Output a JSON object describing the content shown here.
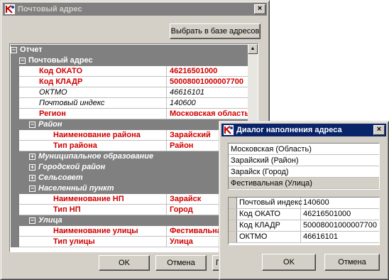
{
  "main": {
    "title": "Почтовый адрес",
    "close_glyph": "×",
    "select_button": "Выбрать в базе адресов",
    "ok_button": "OK",
    "cancel_button": "Отмена",
    "third_button": "П",
    "grid": {
      "root": "Отчет",
      "section": "Почтовый адрес",
      "rows": [
        {
          "name": "Код ОКАТО",
          "value": "46216501000"
        },
        {
          "name": "Код КЛАДР",
          "value": "50008001000007700"
        },
        {
          "name": "ОКТМО",
          "value": "46616101"
        },
        {
          "name": "Почтовый индекс",
          "value": "140600"
        },
        {
          "name": "Регион",
          "value": "Московская область"
        }
      ],
      "rayon": "Район",
      "rayon_rows": [
        {
          "name": "Наименование района",
          "value": "Зарайский"
        },
        {
          "name": "Тип района",
          "value": "Район"
        }
      ],
      "collapsed": [
        "Муниципальное образование",
        "Городской район",
        "Сельсовет"
      ],
      "np": "Населенный пункт",
      "np_rows": [
        {
          "name": "Наименование НП",
          "value": "Зарайск"
        },
        {
          "name": "Тип НП",
          "value": "Город"
        }
      ],
      "street": "Улица",
      "street_rows": [
        {
          "name": "Наименование улицы",
          "value": "Фестивальная"
        },
        {
          "name": "Тип улицы",
          "value": "Улица"
        }
      ]
    }
  },
  "address_dialog": {
    "title": "Диалог наполнения адреса",
    "close_glyph": "×",
    "levels": [
      "Московская (Область)",
      "Зарайский (Район)",
      "Зарайск (Город)",
      "Фестивальная (Улица)"
    ],
    "codes": [
      {
        "label": "Почтовый индекс",
        "value": "140600"
      },
      {
        "label": "Код ОКАТО",
        "value": "46216501000"
      },
      {
        "label": "Код КЛАДР",
        "value": "50008001000007700"
      },
      {
        "label": "ОКТМО",
        "value": "46616101"
      }
    ],
    "ok_button": "OK",
    "cancel_button": "Отмена"
  },
  "colors": {
    "required_text": "#d00000",
    "active_title": "#0a246a",
    "inactive_title": "#808080"
  }
}
